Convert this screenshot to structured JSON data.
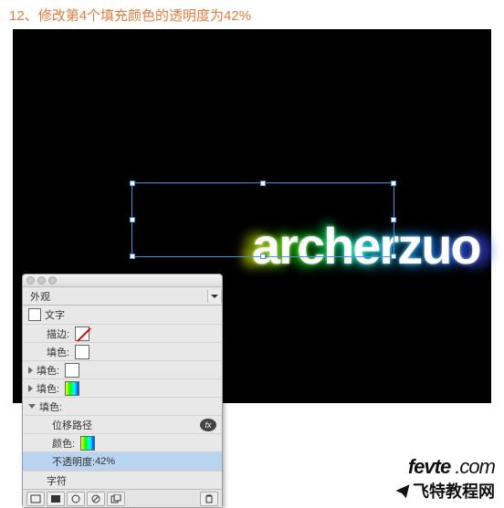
{
  "instruction": {
    "step": "12、",
    "text": "修改第4个填充颜色的透明度为42%"
  },
  "artwork_text": "archerzuo",
  "panel": {
    "tab_label": "外观",
    "type_label": "文字",
    "stroke_label": "描边:",
    "fill_label": "填色:",
    "offset_path_label": "位移路径",
    "color_label": "颜色:",
    "opacity_label": "不透明度:",
    "opacity_value": "42%",
    "chars_label": "字符",
    "fx_badge": "fx"
  },
  "watermark": {
    "url_bold": "fevte",
    "url_rest": " .com",
    "cn": "飞特教程网"
  }
}
